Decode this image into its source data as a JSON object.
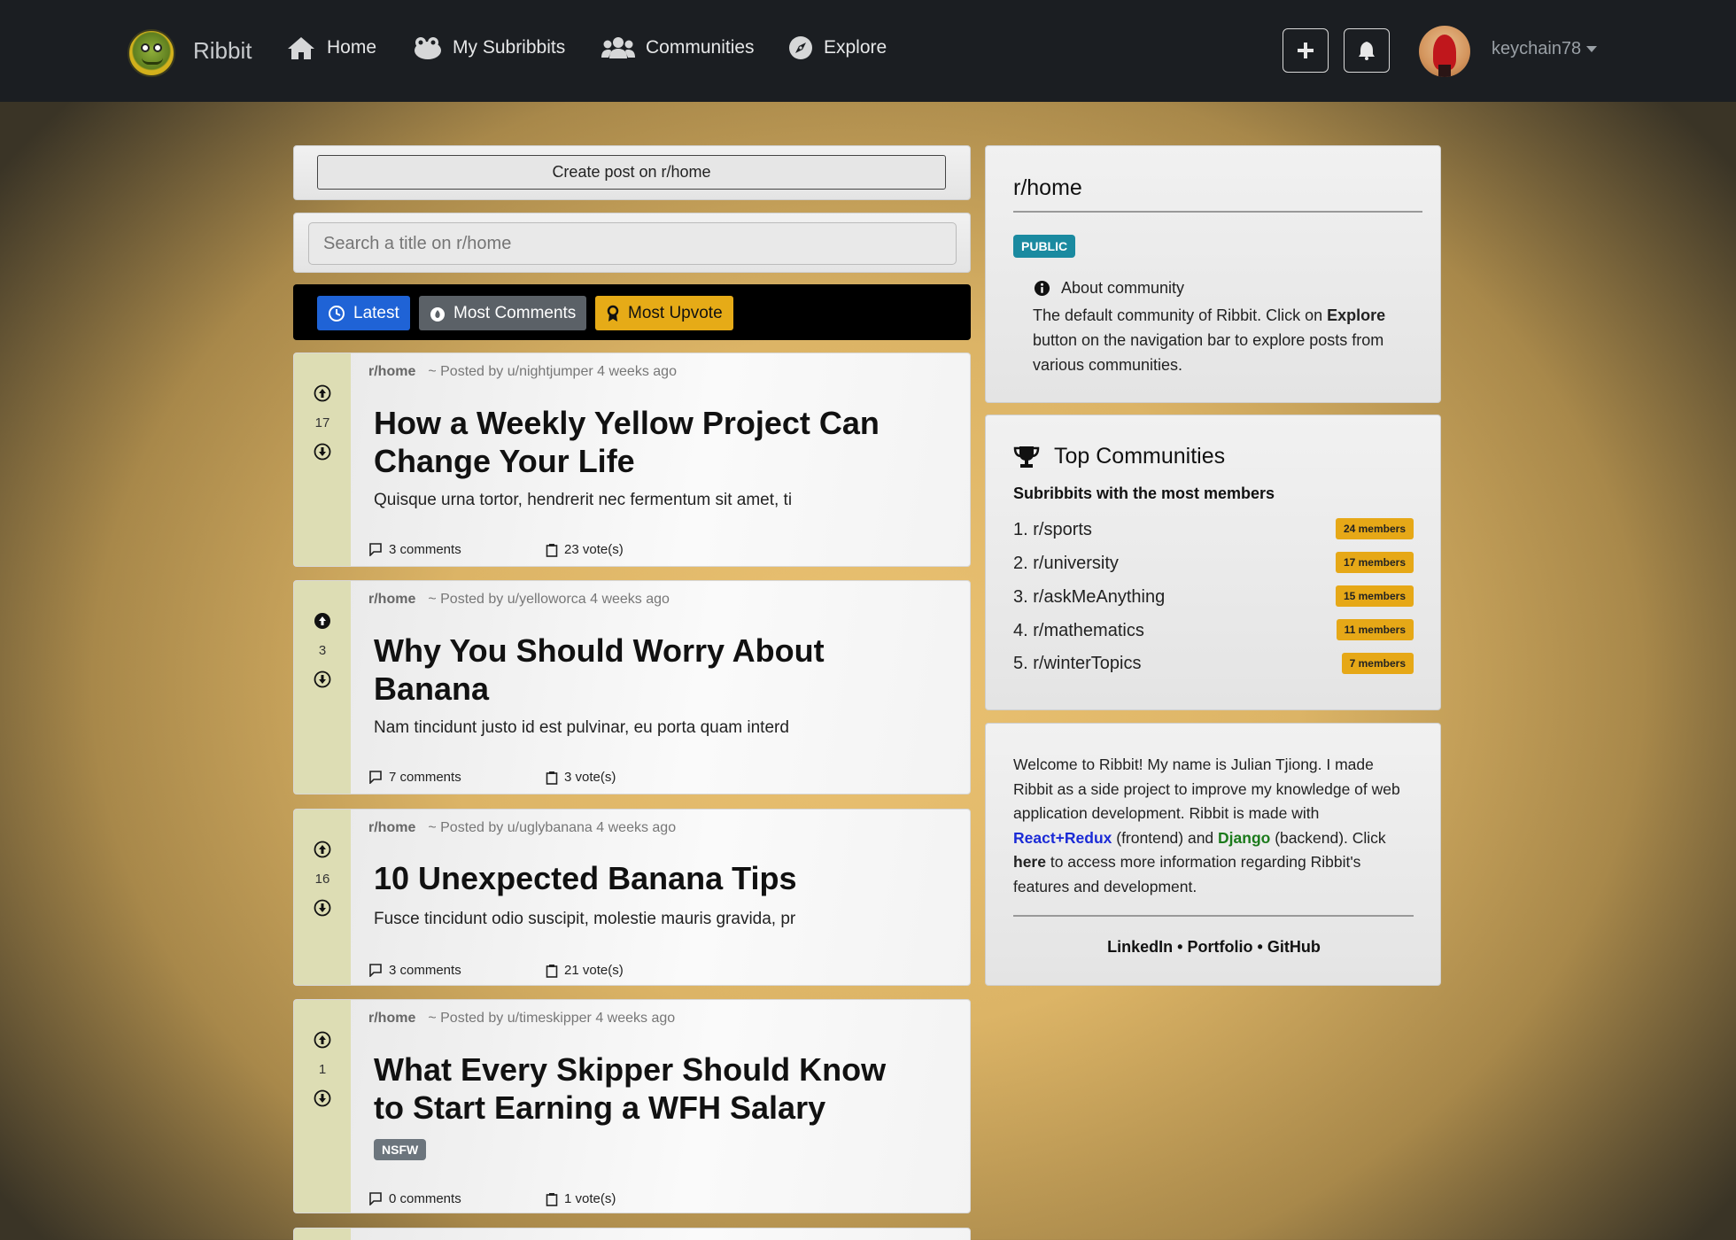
{
  "navbar": {
    "brand": "Ribbit",
    "links": [
      "Home",
      "My Subribbits",
      "Communities",
      "Explore"
    ],
    "username": "keychain78"
  },
  "create_post": {
    "label": "Create post on r/home"
  },
  "search": {
    "placeholder": "Search a title on r/home"
  },
  "sort": {
    "latest": "Latest",
    "most_comments": "Most Comments",
    "most_upvote": "Most Upvote",
    "colors": {
      "latest": "#1f63d6",
      "most_comments": "#5b6167",
      "most_upvote": "#e6ab17"
    }
  },
  "posts": [
    {
      "subribbit": "r/home",
      "meta": "~ Posted by u/nightjumper 4 weeks ago",
      "votes": "17",
      "title": "How a Weekly Yellow Project Can Change Your Life",
      "body": "Quisque urna tortor, hendrerit nec fermentum sit amet, ti",
      "comments": "3 comments",
      "vote_label": "23 vote(s)"
    },
    {
      "subribbit": "r/home",
      "meta": "~ Posted by u/yelloworca 4 weeks ago",
      "votes": "3",
      "title": "Why You Should Worry About Banana",
      "body": "Nam tincidunt justo id est pulvinar, eu porta quam interd",
      "comments": "7 comments",
      "vote_label": "3 vote(s)"
    },
    {
      "subribbit": "r/home",
      "meta": "~ Posted by u/uglybanana 4 weeks ago",
      "votes": "16",
      "title": "10 Unexpected Banana Tips",
      "body": "Fusce tincidunt odio suscipit, molestie mauris gravida, pr",
      "comments": "3 comments",
      "vote_label": "21 vote(s)"
    },
    {
      "subribbit": "r/home",
      "meta": "~ Posted by u/timeskipper 4 weeks ago",
      "votes": "1",
      "title": "What Every Skipper Should Know to Start Earning a WFH Salary",
      "badge": "NSFW",
      "comments": "0 comments",
      "vote_label": "1 vote(s)"
    }
  ],
  "about": {
    "title": "r/home",
    "badge": "PUBLIC",
    "heading": "About community",
    "text_pre": "The default community of Ribbit. Click on ",
    "text_bold": "Explore",
    "text_post": " button on the navigation bar to explore posts from various communities."
  },
  "top_communities": {
    "title": "Top Communities",
    "subtitle": "Subribbits with the most members",
    "items": [
      {
        "name": "1. r/sports",
        "members": "24 members"
      },
      {
        "name": "2. r/university",
        "members": "17 members"
      },
      {
        "name": "3. r/askMeAnything",
        "members": "15 members"
      },
      {
        "name": "4. r/mathematics",
        "members": "11 members"
      },
      {
        "name": "5. r/winterTopics",
        "members": "7 members"
      }
    ]
  },
  "welcome": {
    "t1": "Welcome to Ribbit! My name is Julian Tjiong. I made Ribbit as a side project to improve my knowledge of web application development. Ribbit is made with ",
    "react": "React+Redux",
    "t2": " (frontend) and ",
    "django": "Django",
    "t3": " (backend). Click ",
    "here": "here",
    "t4": " to access more information regarding Ribbit's features and development.",
    "links": [
      "LinkedIn",
      "Portfolio",
      "GitHub"
    ],
    "sep": "•"
  }
}
